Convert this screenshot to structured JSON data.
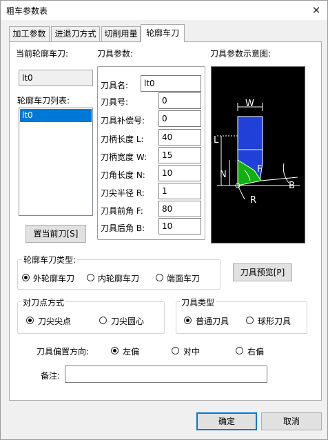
{
  "window": {
    "title": "粗车参数表",
    "close_glyph": "✕"
  },
  "tabs": [
    {
      "label": "加工参数"
    },
    {
      "label": "进退刀方式"
    },
    {
      "label": "切削用量"
    },
    {
      "label": "轮廓车刀"
    }
  ],
  "left": {
    "current_tool_label": "当前轮廓车刀:",
    "current_tool_value": "lt0",
    "tool_list_label": "轮廓车刀列表:",
    "tool_list": [
      "lt0"
    ],
    "set_current_button": "置当前刀[S]"
  },
  "params": {
    "header": "刀具参数:",
    "rows": [
      {
        "label": "刀具名:",
        "value": "lt0"
      },
      {
        "label": "刀具号:",
        "value": "0"
      },
      {
        "label": "刀具补偿号:",
        "value": "0"
      },
      {
        "label": "刀柄长度 L:",
        "value": "40"
      },
      {
        "label": "刀柄宽度 W:",
        "value": "15"
      },
      {
        "label": "刀角长度 N:",
        "value": "10"
      },
      {
        "label": "刀尖半径 R:",
        "value": "1"
      },
      {
        "label": "刀具前角 F:",
        "value": "80"
      },
      {
        "label": "刀具后角 B:",
        "value": "10"
      }
    ]
  },
  "diagram": {
    "header": "刀具参数示意图:",
    "labels": {
      "W": "W",
      "L": "L",
      "N": "N",
      "F": "F",
      "R": "R",
      "B": "B"
    },
    "colors": {
      "background": "#000000",
      "holder": "#2040d8",
      "tip": "#10b010",
      "line": "#ffffff"
    }
  },
  "tool_type_group": {
    "title": "轮廓车刀类型:",
    "options": [
      "外轮廓车刀",
      "内轮廓车刀",
      "端面车刀"
    ],
    "selected": "外轮廓车刀"
  },
  "preview_button": "刀具预览[P]",
  "align_group": {
    "title": "对刀点方式",
    "options": [
      "刀尖尖点",
      "刀尖圆心"
    ],
    "selected": "刀尖尖点"
  },
  "kind_group": {
    "title": "刀具类型",
    "options": [
      "普通刀具",
      "球形刀具"
    ],
    "selected": "普通刀具"
  },
  "offset": {
    "label": "刀具偏置方向:",
    "options": [
      "左偏",
      "对中",
      "右偏"
    ],
    "selected": "左偏"
  },
  "note": {
    "label": "备注:",
    "value": ""
  },
  "footer": {
    "ok": "确定",
    "cancel": "取消"
  }
}
